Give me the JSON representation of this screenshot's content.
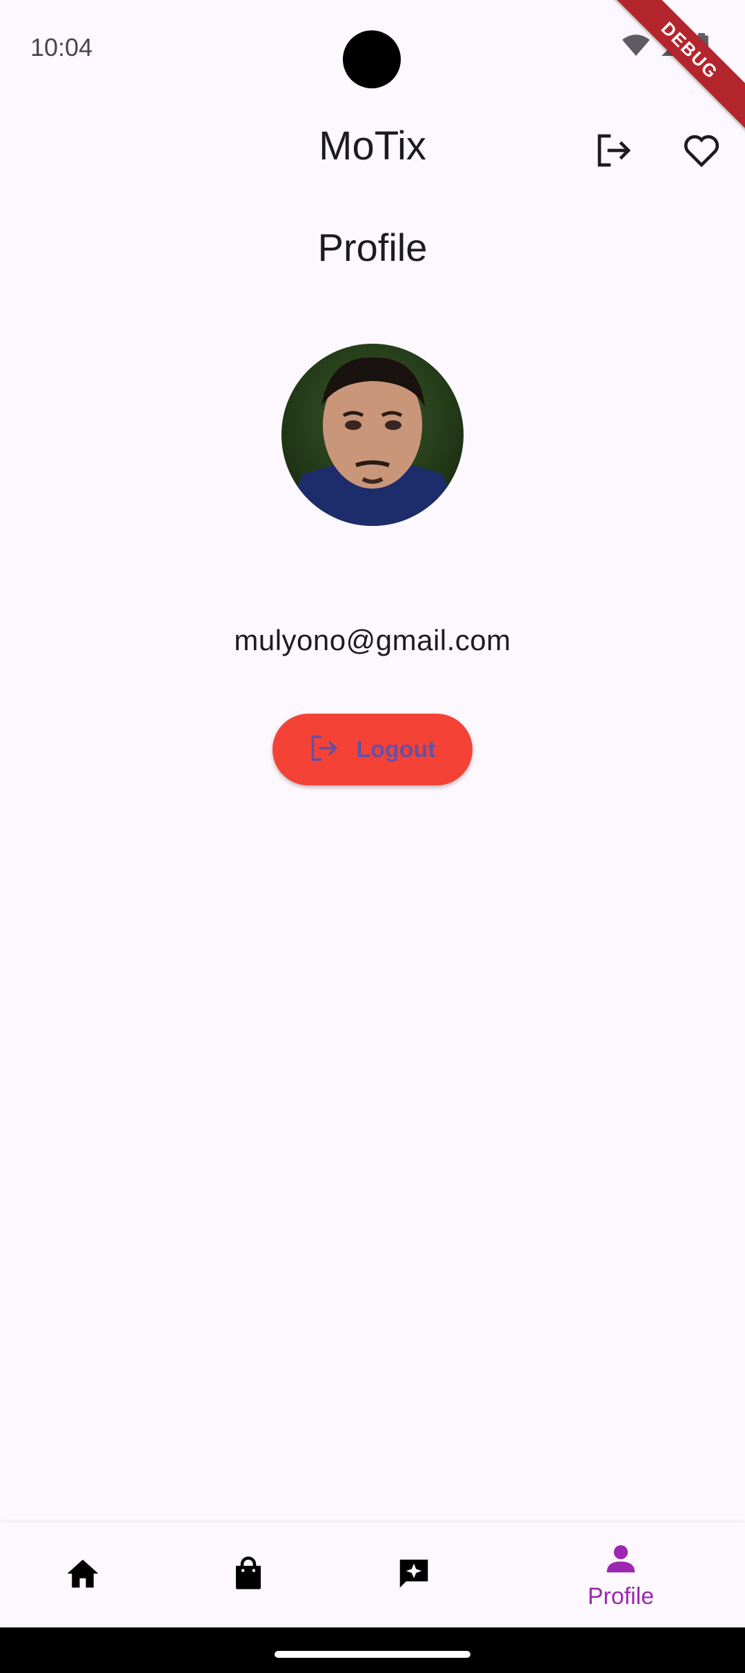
{
  "status_bar": {
    "time": "10:04",
    "icons": [
      "wifi-icon",
      "signal-icon",
      "battery-icon"
    ]
  },
  "debug_banner": "DEBUG",
  "app_bar": {
    "title": "MoTix",
    "actions": [
      "logout-icon",
      "favorite-icon"
    ]
  },
  "profile": {
    "title": "Profile",
    "email": "mulyono@gmail.com",
    "logout_label": "Logout"
  },
  "bottom_nav": {
    "items": [
      {
        "icon": "home-icon",
        "label": ""
      },
      {
        "icon": "shopping-bag-icon",
        "label": ""
      },
      {
        "icon": "review-icon",
        "label": ""
      },
      {
        "icon": "person-icon",
        "label": "Profile",
        "active": true
      }
    ]
  },
  "colors": {
    "background": "#fdf7fe",
    "accent": "#9c27b0",
    "logout_button": "#f44336",
    "logout_text": "#6750a4"
  }
}
